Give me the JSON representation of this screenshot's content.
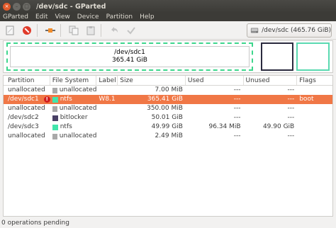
{
  "window": {
    "title": "/dev/sdc - GParted",
    "close_glyph": "×",
    "min_glyph": "–",
    "max_glyph": "□"
  },
  "menu": [
    "GParted",
    "Edit",
    "View",
    "Device",
    "Partition",
    "Help"
  ],
  "toolbar": {
    "icons": [
      "new-partition-icon",
      "delete-partition-icon",
      "resize-move-icon",
      "copy-icon",
      "paste-icon",
      "undo-icon",
      "apply-icon"
    ],
    "device_selector": "/dev/sdc   (465.76 GiB)"
  },
  "diskmap": {
    "sdc1_name": "/dev/sdc1",
    "sdc1_size": "365.41 GiB",
    "colors": {
      "ntfs": "#42e5ac",
      "bitlocker": "#494066",
      "unallocated": "#a9a9a9"
    }
  },
  "table": {
    "headers": [
      "Partition",
      "File System",
      "Label",
      "Size",
      "Used",
      "Unused",
      "Flags"
    ],
    "rows": [
      {
        "partition": "unallocated",
        "fs": "unallocated",
        "fs_color": "#a9a9a9",
        "label": "",
        "size": "7.00 MiB",
        "used": "---",
        "unused": "---",
        "flags": "",
        "selected": false,
        "warning": false
      },
      {
        "partition": "/dev/sdc1",
        "fs": "ntfs",
        "fs_color": "#42e5ac",
        "label": "W8.1",
        "size": "365.41 GiB",
        "used": "---",
        "unused": "---",
        "flags": "boot",
        "selected": true,
        "warning": true
      },
      {
        "partition": "unallocated",
        "fs": "unallocated",
        "fs_color": "#a9a9a9",
        "label": "",
        "size": "350.00 MiB",
        "used": "---",
        "unused": "---",
        "flags": "",
        "selected": false,
        "warning": false
      },
      {
        "partition": "/dev/sdc2",
        "fs": "bitlocker",
        "fs_color": "#494066",
        "label": "",
        "size": "50.01 GiB",
        "used": "---",
        "unused": "---",
        "flags": "",
        "selected": false,
        "warning": false
      },
      {
        "partition": "/dev/sdc3",
        "fs": "ntfs",
        "fs_color": "#42e5ac",
        "label": "",
        "size": "49.99 GiB",
        "used": "96.34 MiB",
        "unused": "49.90 GiB",
        "flags": "",
        "selected": false,
        "warning": false
      },
      {
        "partition": "unallocated",
        "fs": "unallocated",
        "fs_color": "#a9a9a9",
        "label": "",
        "size": "2.49 MiB",
        "used": "---",
        "unused": "---",
        "flags": "",
        "selected": false,
        "warning": false
      }
    ]
  },
  "status": "0 operations pending"
}
